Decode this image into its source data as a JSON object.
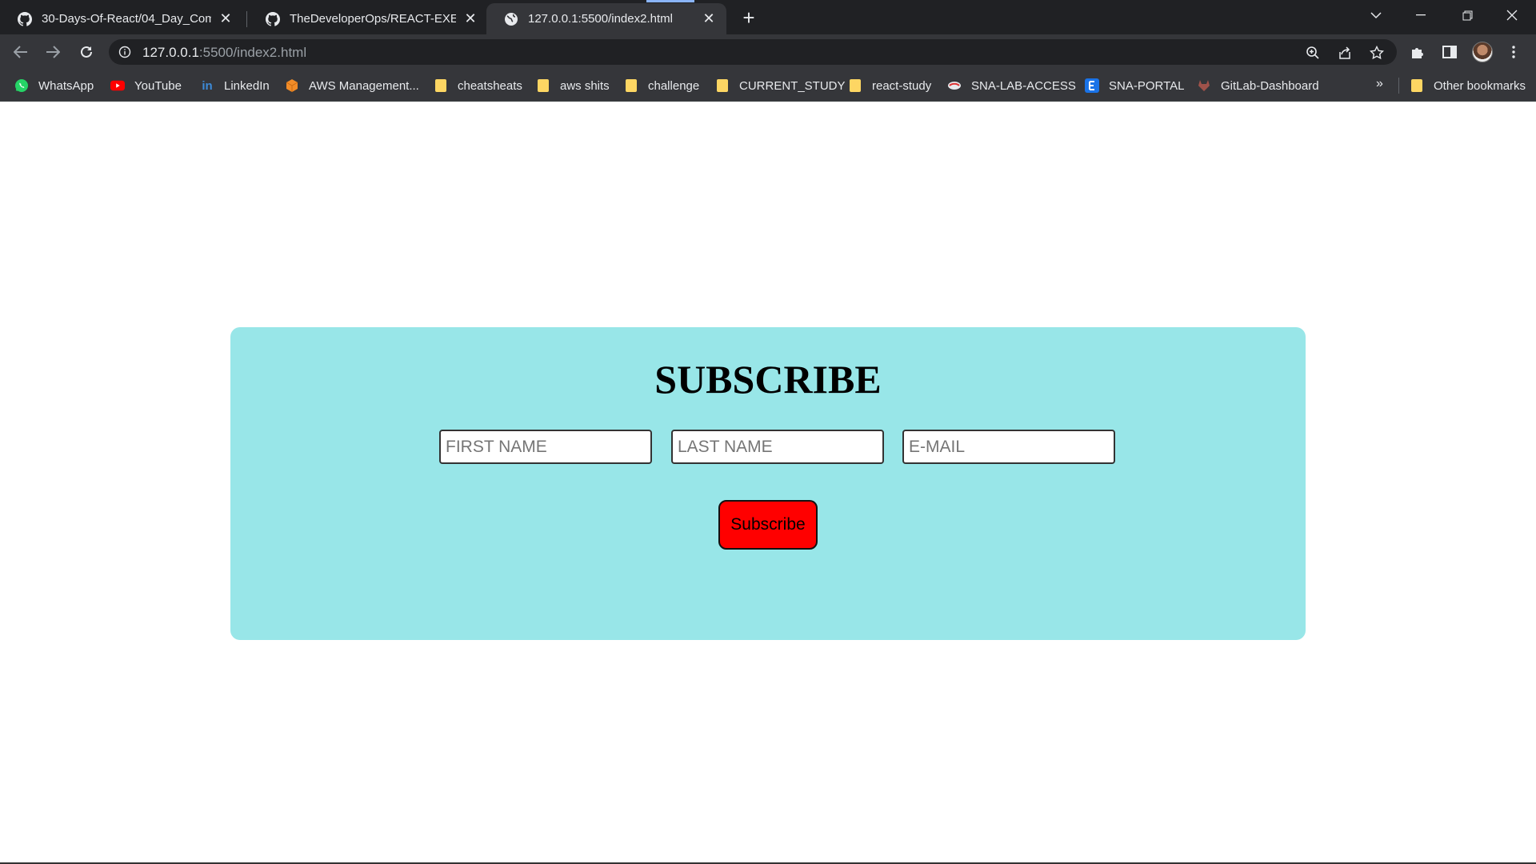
{
  "browser": {
    "tabs": [
      {
        "title": "30-Days-Of-React/04_Day_Comp",
        "icon": "github-icon",
        "active": false
      },
      {
        "title": "TheDeveloperOps/REACT-EXERCI",
        "icon": "github-icon",
        "active": false
      },
      {
        "title": "127.0.0.1:5500/index2.html",
        "icon": "globe-icon",
        "active": true
      }
    ],
    "new_tab_label": "+",
    "address": {
      "host": "127.0.0.1",
      "rest": ":5500/index2.html"
    },
    "bookmarks": [
      {
        "label": "WhatsApp",
        "icon": "whatsapp-icon",
        "color": "#25d366"
      },
      {
        "label": "YouTube",
        "icon": "youtube-icon",
        "color": "#ff0000"
      },
      {
        "label": "LinkedIn",
        "icon": "linkedin-icon",
        "color": "#0a66c2"
      },
      {
        "label": "AWS Management...",
        "icon": "aws-icon",
        "color": "#f28c28"
      },
      {
        "label": "cheatsheats",
        "icon": "folder-icon"
      },
      {
        "label": "aws shits",
        "icon": "folder-icon"
      },
      {
        "label": "challenge",
        "icon": "folder-icon"
      },
      {
        "label": "CURRENT_STUDY",
        "icon": "folder-icon"
      },
      {
        "label": "react-study",
        "icon": "folder-icon"
      },
      {
        "label": "SNA-LAB-ACCESS",
        "icon": "sna-lab-icon"
      },
      {
        "label": "SNA-PORTAL",
        "icon": "sna-portal-icon",
        "color": "#1a73e8"
      },
      {
        "label": "GitLab-Dashboard",
        "icon": "gitlab-icon"
      }
    ],
    "more_bookmarks": "»",
    "other_bookmarks": "Other bookmarks"
  },
  "page": {
    "heading": "SUBSCRIBE",
    "fields": {
      "first_name_placeholder": "FIRST NAME",
      "last_name_placeholder": "LAST NAME",
      "email_placeholder": "E-MAIL"
    },
    "button_label": "Subscribe",
    "colors": {
      "card_background": "#98e6e8",
      "button_background": "#ff0000"
    }
  }
}
